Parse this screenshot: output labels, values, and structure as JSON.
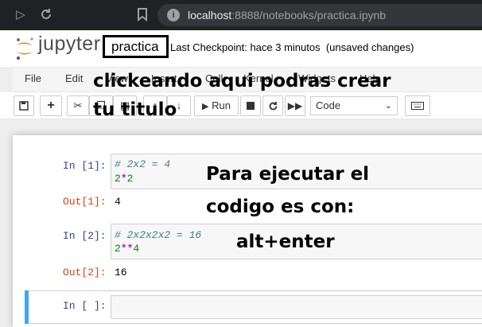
{
  "browser": {
    "url_host": "localhost",
    "url_path": ":8888/notebooks/practica.ipynb",
    "icons": [
      "forward-icon",
      "reload-icon",
      "bookmark-icon",
      "info-icon"
    ]
  },
  "header": {
    "wordmark": "jupyter",
    "notebook_title": "practica",
    "checkpoint": "Last Checkpoint: hace 3 minutos",
    "unsaved": "(unsaved changes)",
    "logo_color": "#f37726"
  },
  "menu": {
    "file": "File",
    "edit": "Edit",
    "view": "View",
    "insert": "Insert",
    "cell": "Cell",
    "kernel": "Kernel",
    "widgets": "Widgets",
    "help": "Help"
  },
  "toolbar": {
    "run_label": "Run",
    "cell_type": "Code",
    "icons": [
      "save-icon",
      "add-icon",
      "cut-icon",
      "copy-icon",
      "paste-icon",
      "move-up-icon",
      "move-down-icon",
      "run-icon",
      "stop-icon",
      "restart-icon",
      "fast-forward-icon",
      "keyboard-icon"
    ]
  },
  "cells": [
    {
      "in_prompt": "In [1]:",
      "comment": "# 2x2 = 4",
      "code_a": "2",
      "code_op": "*",
      "code_b": "2",
      "out_prompt": "Out[1]:",
      "output": "4"
    },
    {
      "in_prompt": "In [2]:",
      "comment": "# 2x2x2x2 = 16",
      "code_a": "2",
      "code_op": "**",
      "code_b": "4",
      "out_prompt": "Out[2]:",
      "output": "16"
    },
    {
      "in_prompt": "In [ ]:"
    }
  ],
  "annotations": {
    "title_line1": "clickeando aqui podras crear",
    "title_line2": "tu titulo",
    "run_line1": "Para ejecutar el",
    "run_line2": "codigo es con:",
    "run_line3": "alt+enter"
  },
  "colors": {
    "browser_bar": "#202124",
    "selected_cell_bar": "#42a5f5",
    "in_prompt": "#303f9f",
    "out_prompt": "#d84315"
  }
}
